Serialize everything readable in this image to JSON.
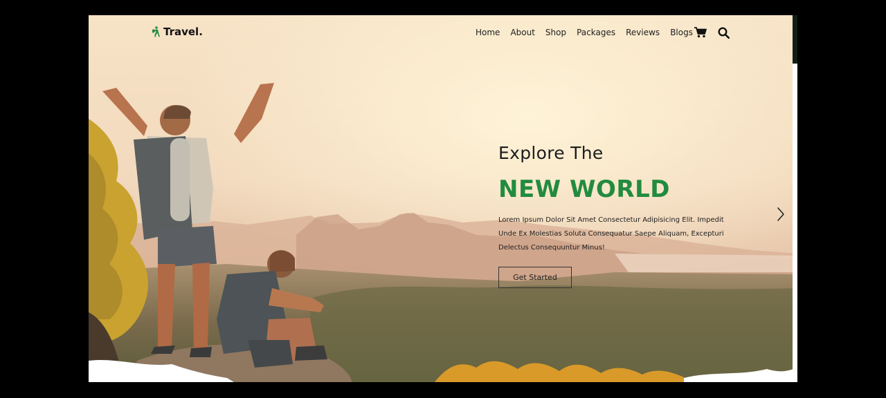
{
  "brand": {
    "name": "Travel.",
    "icon": "hiker-icon",
    "accent_color": "#228b3f"
  },
  "nav": {
    "links": [
      "Home",
      "About",
      "Shop",
      "Packages",
      "Reviews",
      "Blogs"
    ],
    "cart_icon": "cart-icon",
    "search_icon": "search-icon"
  },
  "hero": {
    "subtitle": "Explore The",
    "title": "NEW WORLD",
    "text": "Lorem Ipsum Dolor Sit Amet Consectetur Adipisicing Elit. Impedit Unde Ex Molestias Soluta Consequatur Saepe Aliquam, Excepturi Delectus Consequuntur Minus!",
    "cta_label": "Get Started",
    "next_icon": "chevron-right-icon"
  }
}
